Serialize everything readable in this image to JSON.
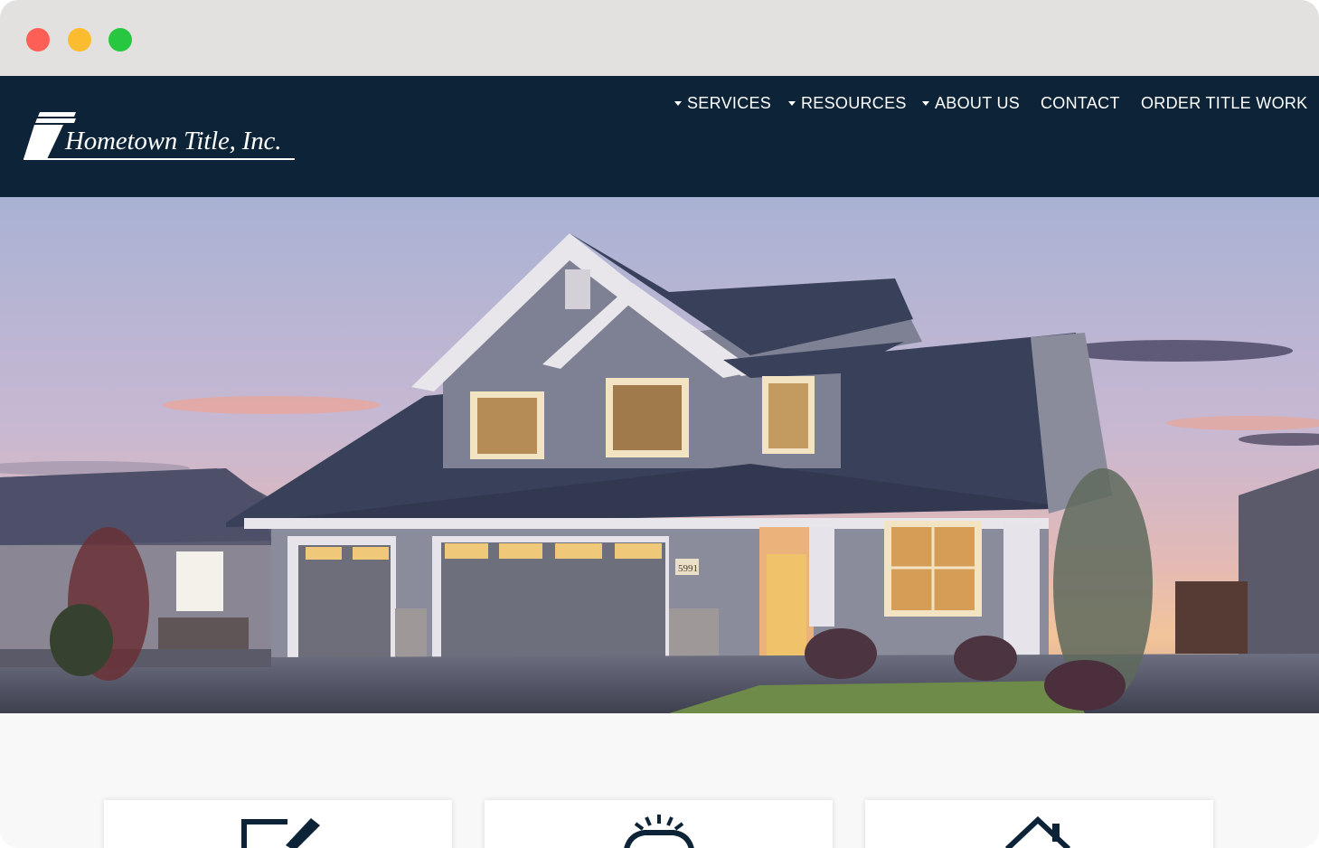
{
  "window": {
    "controls": [
      "close",
      "minimize",
      "zoom"
    ]
  },
  "brand": {
    "name": "Hometown Title, Inc.",
    "colors": {
      "header_bg": "#0d2438",
      "text": "#ffffff",
      "page_bg": "#f8f8f8"
    }
  },
  "nav": {
    "items": [
      {
        "label": "SERVICES",
        "has_dropdown": true
      },
      {
        "label": "RESOURCES",
        "has_dropdown": true
      },
      {
        "label": "ABOUT US",
        "has_dropdown": true
      },
      {
        "label": "CONTACT",
        "has_dropdown": false
      },
      {
        "label": "ORDER TITLE WORK",
        "has_dropdown": false
      }
    ]
  },
  "hero": {
    "image": "two-story-house-at-dusk",
    "house_number": "5991"
  },
  "cards": [
    {
      "icon": "pen-signature-icon"
    },
    {
      "icon": "handshake-icon"
    },
    {
      "icon": "house-icon"
    }
  ]
}
